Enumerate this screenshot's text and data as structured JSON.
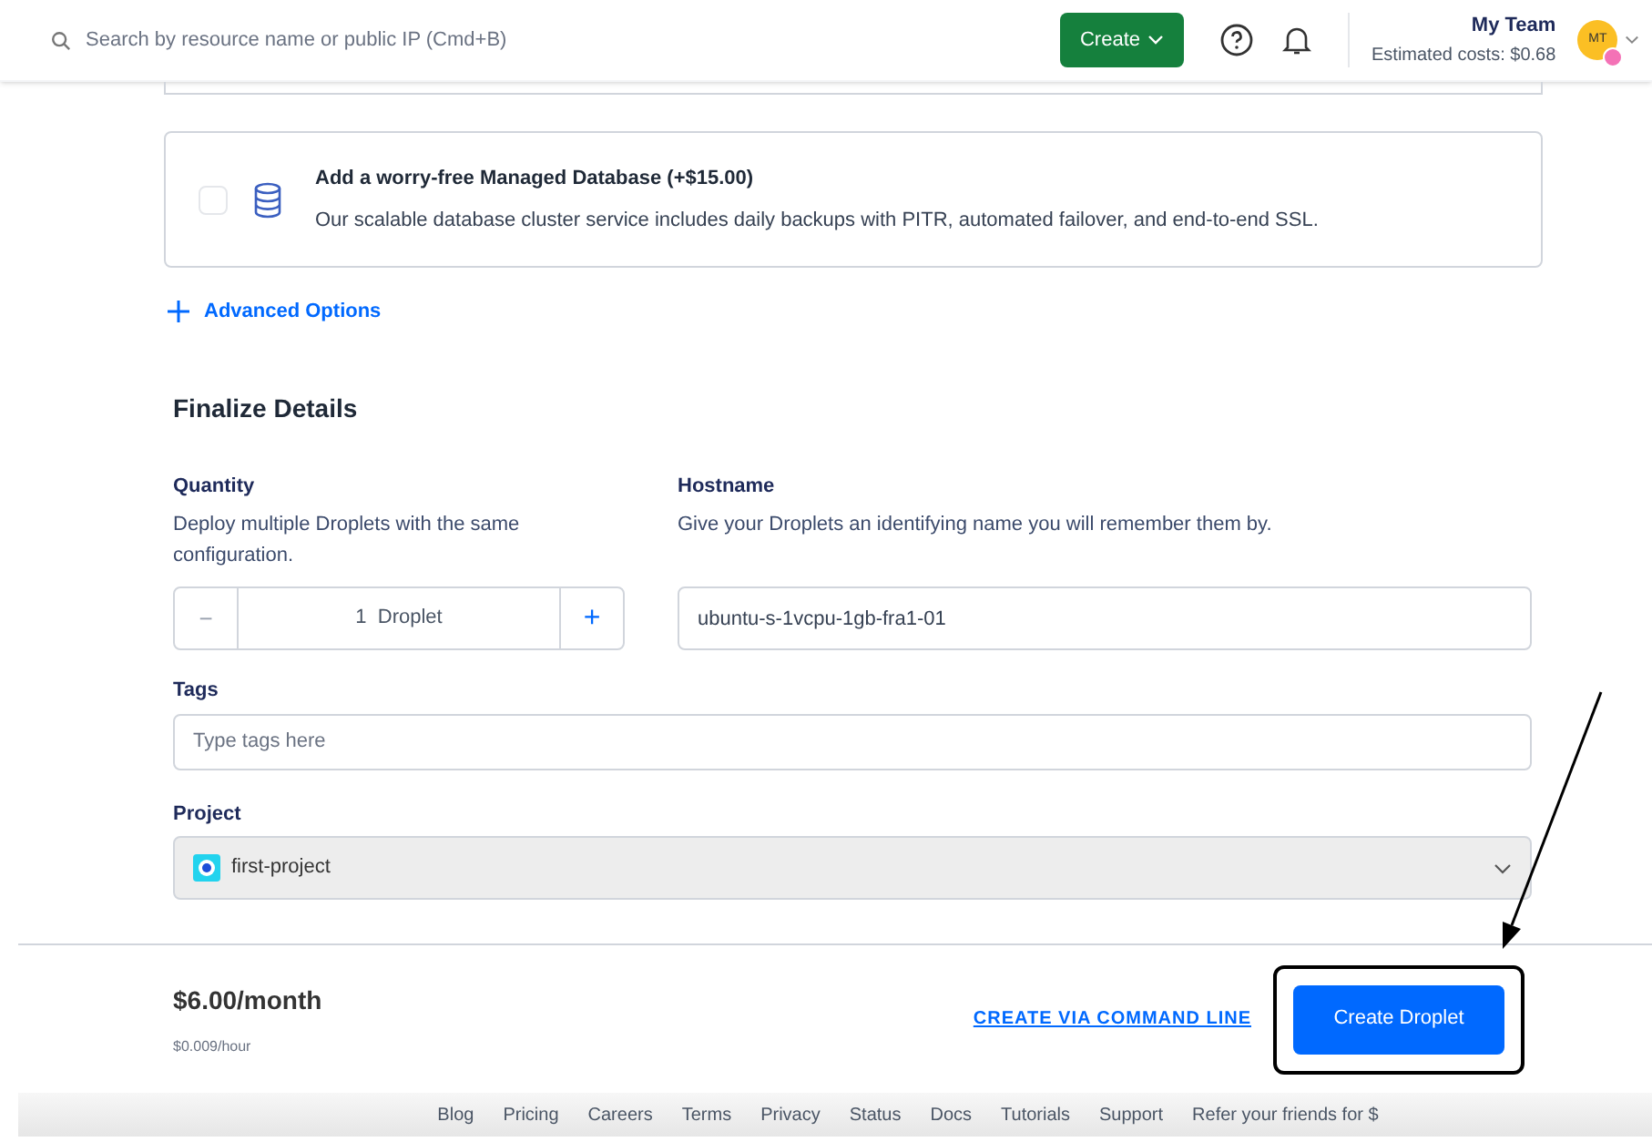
{
  "topbar": {
    "search": {
      "placeholder": "Search by resource name or public IP (Cmd+B)"
    },
    "create_button": "Create",
    "team": {
      "name": "My Team",
      "costs": "Estimated costs: $0.68",
      "initials": "MT"
    }
  },
  "database_addon": {
    "checked": false,
    "title": "Add a worry-free Managed Database (+$15.00)",
    "description": "Our scalable database cluster service includes daily backups with PITR, automated failover, and end-to-end SSL."
  },
  "advanced_options": "Advanced Options",
  "finalize": {
    "heading": "Finalize Details",
    "quantity": {
      "label": "Quantity",
      "help": "Deploy multiple Droplets with the same configuration.",
      "value": "1  Droplet",
      "minus": "−",
      "plus": "+"
    },
    "hostname": {
      "label": "Hostname",
      "help": "Give your Droplets an identifying name you will remember them by.",
      "value": "ubuntu-s-1vcpu-1gb-fra1-01"
    },
    "tags": {
      "label": "Tags",
      "placeholder": "Type tags here"
    },
    "project": {
      "label": "Project",
      "value": "first-project"
    }
  },
  "summary": {
    "price": "$6.00/month",
    "hourly": "$0.009/hour",
    "cli_link": "CREATE VIA COMMAND LINE",
    "create_button": "Create Droplet",
    "highlighted": true
  },
  "footer_links": [
    "Blog",
    "Pricing",
    "Careers",
    "Terms",
    "Privacy",
    "Status",
    "Docs",
    "Tutorials",
    "Support",
    "Refer your friends for $"
  ]
}
